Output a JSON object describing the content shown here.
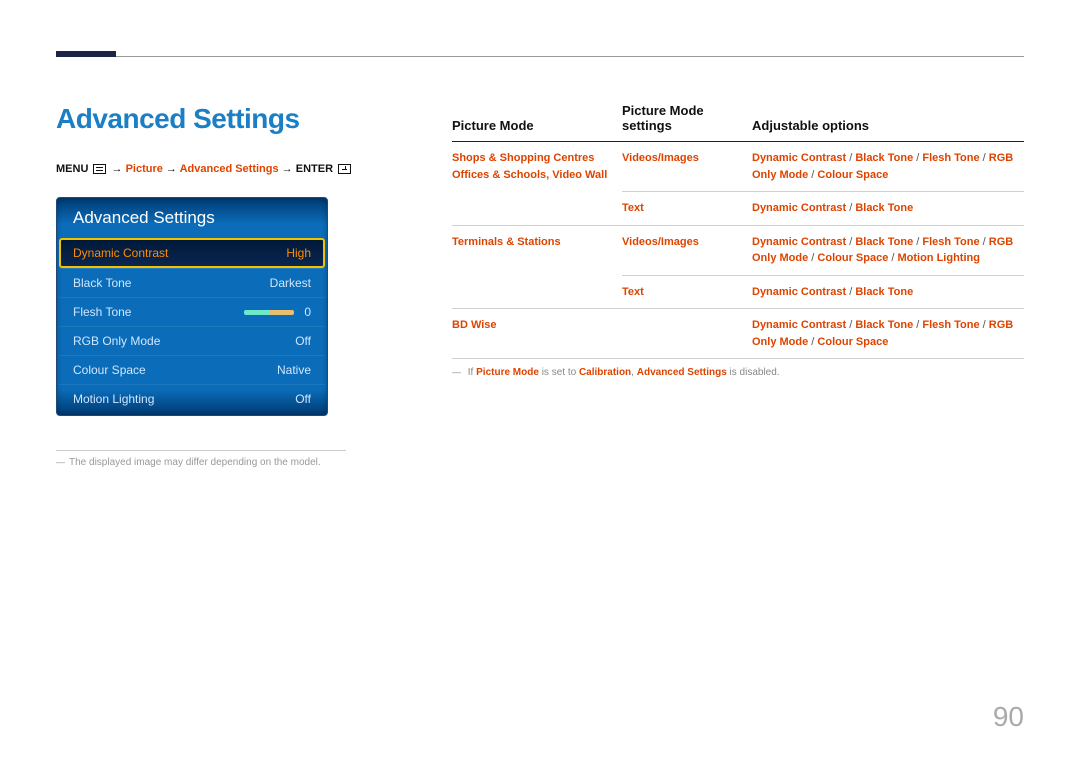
{
  "page": {
    "title": "Advanced Settings",
    "page_number": "90"
  },
  "breadcrumb": {
    "parts": [
      "MENU",
      "Picture",
      "Advanced Settings",
      "ENTER"
    ]
  },
  "osd": {
    "title": "Advanced Settings",
    "rows": [
      {
        "label": "Dynamic Contrast",
        "value": "High",
        "selected": true
      },
      {
        "label": "Black Tone",
        "value": "Darkest"
      },
      {
        "label": "Flesh Tone",
        "value": "0",
        "slider": true
      },
      {
        "label": "RGB Only Mode",
        "value": "Off"
      },
      {
        "label": "Colour Space",
        "value": "Native"
      },
      {
        "label": "Motion Lighting",
        "value": "Off"
      }
    ],
    "footnote": "The displayed image may differ depending on the model."
  },
  "table": {
    "headers": [
      "Picture Mode",
      "Picture Mode settings",
      "Adjustable options"
    ],
    "rows": [
      {
        "mode": "Shops & Shopping Centres Offices & Schools, Video Wall",
        "subrows": [
          {
            "setting": "Videos/Images",
            "options": "Dynamic Contrast / Black Tone / Flesh Tone / RGB Only Mode / Colour Space"
          },
          {
            "setting": "Text",
            "options": "Dynamic Contrast / Black Tone"
          }
        ]
      },
      {
        "mode": "Terminals & Stations",
        "subrows": [
          {
            "setting": "Videos/Images",
            "options": "Dynamic Contrast / Black Tone / Flesh Tone / RGB Only Mode / Colour Space / Motion Lighting"
          },
          {
            "setting": "Text",
            "options": "Dynamic Contrast / Black Tone"
          }
        ]
      },
      {
        "mode": "BD Wise",
        "subrows": [
          {
            "setting": "",
            "options": "Dynamic Contrast / Black Tone / Flesh Tone / RGB Only Mode / Colour Space"
          }
        ]
      }
    ],
    "footnote": {
      "prefix": "If ",
      "bold1": "Picture Mode",
      "mid1": " is set to ",
      "bold2": "Calibration",
      "mid2": ", ",
      "bold3": "Advanced Settings",
      "suffix": " is disabled."
    }
  }
}
